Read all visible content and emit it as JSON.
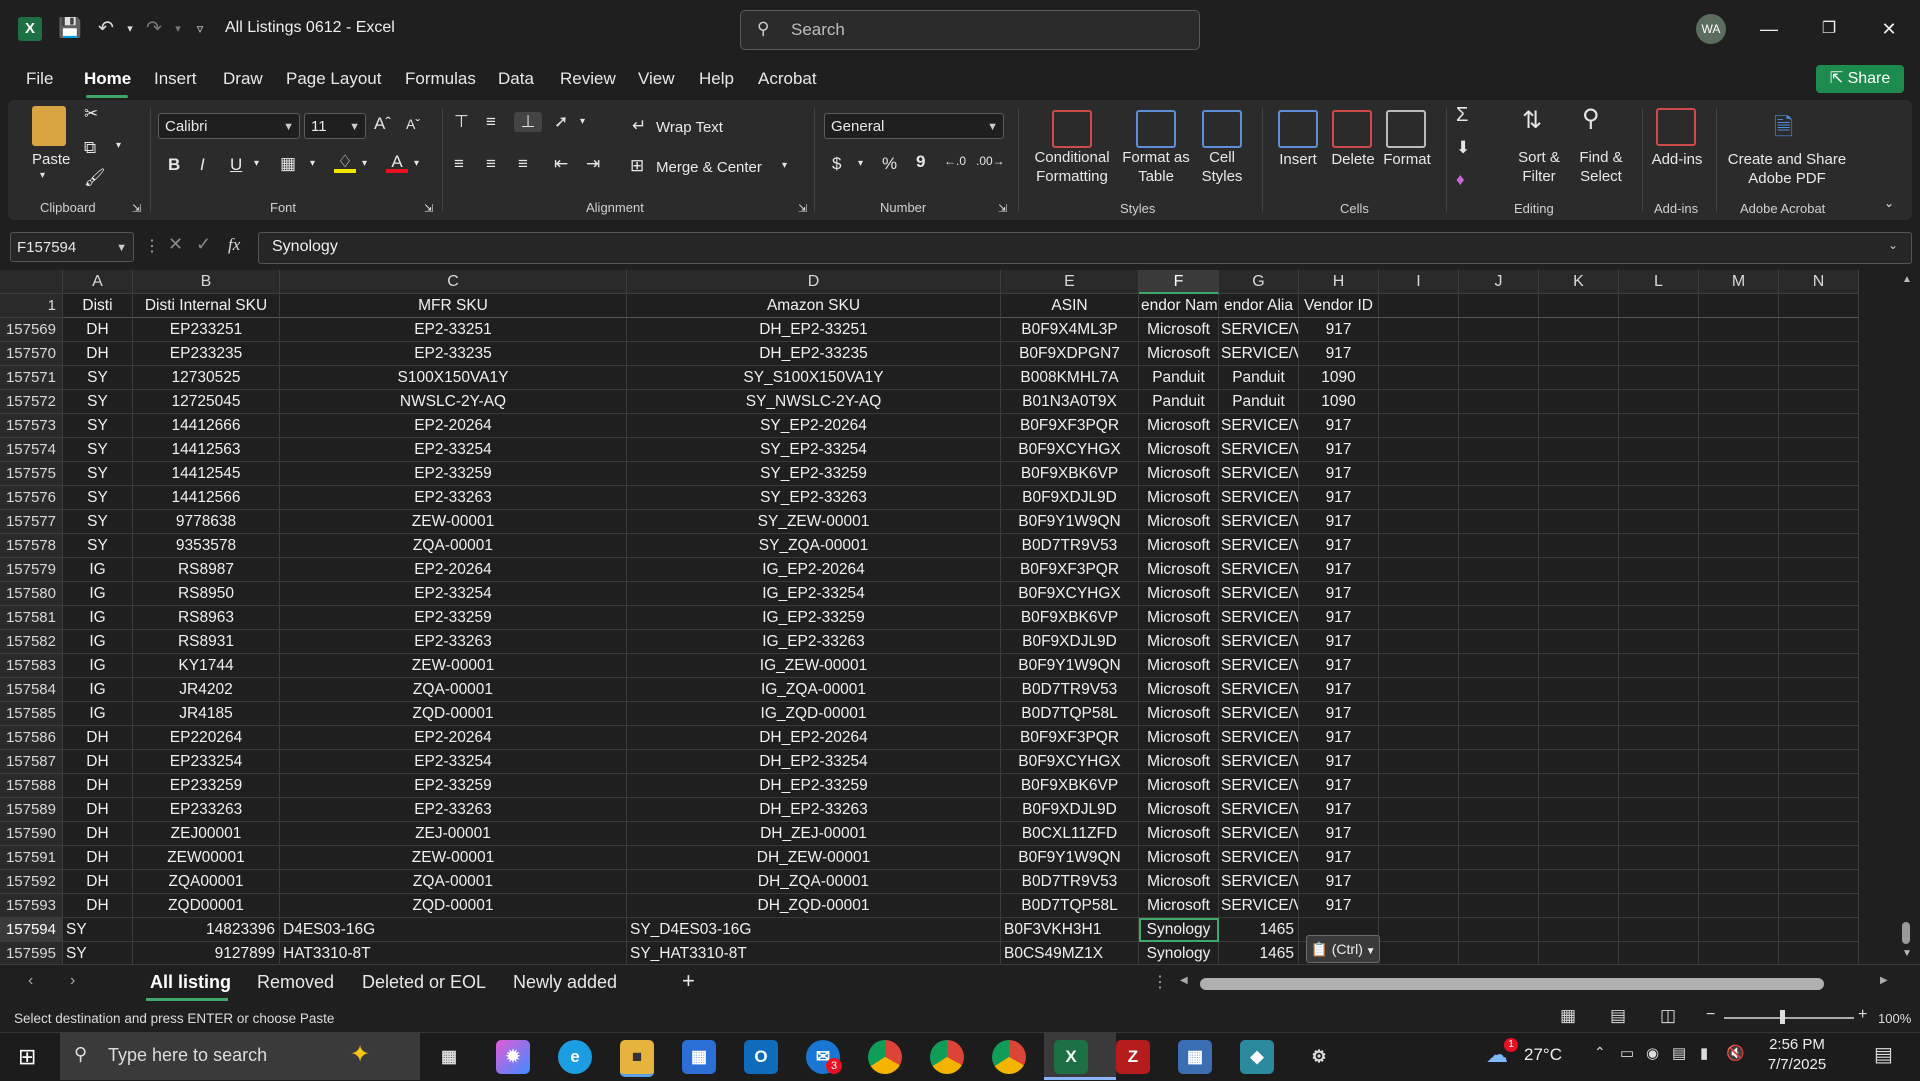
{
  "window": {
    "title": "All Listings 0612  -  Excel",
    "app_logo": "X",
    "avatar": "WA",
    "search_placeholder": "Search"
  },
  "menu": [
    "File",
    "Home",
    "Insert",
    "Draw",
    "Page Layout",
    "Formulas",
    "Data",
    "Review",
    "View",
    "Help",
    "Acrobat"
  ],
  "share_label": "Share",
  "ribbon": {
    "clipboard": {
      "paste": "Paste",
      "group": "Clipboard"
    },
    "font": {
      "name": "Calibri",
      "size": "11",
      "bold": "B",
      "italic": "I",
      "underline": "U",
      "group": "Font"
    },
    "alignment": {
      "wrap": "Wrap Text",
      "merge": "Merge & Center",
      "group": "Alignment"
    },
    "number": {
      "format": "General",
      "currency": "$",
      "percent": "%",
      "comma": "9",
      "group": "Number"
    },
    "styles": {
      "conditional": "Conditional\nFormatting",
      "format_table": "Format as\nTable",
      "cell_styles": "Cell\nStyles",
      "group": "Styles"
    },
    "cells": {
      "insert": "Insert",
      "delete": "Delete",
      "format": "Format",
      "group": "Cells"
    },
    "editing": {
      "sort": "Sort &\nFilter",
      "find": "Find &\nSelect",
      "group": "Editing"
    },
    "addins": {
      "label": "Add-ins",
      "group": "Add-ins"
    },
    "acrobat": {
      "label": "Create and Share\nAdobe PDF",
      "group": "Adobe Acrobat"
    }
  },
  "formula_bar": {
    "name_box": "F157594",
    "fx": "fx",
    "value": "Synology"
  },
  "columns": [
    "A",
    "B",
    "C",
    "D",
    "E",
    "F",
    "G",
    "H",
    "I",
    "J",
    "K",
    "L",
    "M",
    "N"
  ],
  "selected_column": "F",
  "header_row": {
    "num": "1",
    "cells": [
      "Disti",
      "Disti Internal SKU",
      "MFR SKU",
      "Amazon SKU",
      "ASIN",
      "endor Nam",
      "endor Alia",
      "Vendor ID"
    ]
  },
  "rows": [
    {
      "num": "157569",
      "cells": [
        "DH",
        "EP233251",
        "EP2-33251",
        "DH_EP2-33251",
        "B0F9X4ML3P",
        "Microsoft",
        "SERVICE/V",
        "917"
      ]
    },
    {
      "num": "157570",
      "cells": [
        "DH",
        "EP233235",
        "EP2-33235",
        "DH_EP2-33235",
        "B0F9XDPGN7",
        "Microsoft",
        "SERVICE/V",
        "917"
      ]
    },
    {
      "num": "157571",
      "cells": [
        "SY",
        "12730525",
        "S100X150VA1Y",
        "SY_S100X150VA1Y",
        "B008KMHL7A",
        "Panduit",
        "Panduit",
        "1090"
      ]
    },
    {
      "num": "157572",
      "cells": [
        "SY",
        "12725045",
        "NWSLC-2Y-AQ",
        "SY_NWSLC-2Y-AQ",
        "B01N3A0T9X",
        "Panduit",
        "Panduit",
        "1090"
      ]
    },
    {
      "num": "157573",
      "cells": [
        "SY",
        "14412666",
        "EP2-20264",
        "SY_EP2-20264",
        "B0F9XF3PQR",
        "Microsoft",
        "SERVICE/V",
        "917"
      ]
    },
    {
      "num": "157574",
      "cells": [
        "SY",
        "14412563",
        "EP2-33254",
        "SY_EP2-33254",
        "B0F9XCYHGX",
        "Microsoft",
        "SERVICE/V",
        "917"
      ]
    },
    {
      "num": "157575",
      "cells": [
        "SY",
        "14412545",
        "EP2-33259",
        "SY_EP2-33259",
        "B0F9XBK6VP",
        "Microsoft",
        "SERVICE/V",
        "917"
      ]
    },
    {
      "num": "157576",
      "cells": [
        "SY",
        "14412566",
        "EP2-33263",
        "SY_EP2-33263",
        "B0F9XDJL9D",
        "Microsoft",
        "SERVICE/V",
        "917"
      ]
    },
    {
      "num": "157577",
      "cells": [
        "SY",
        "9778638",
        "ZEW-00001",
        "SY_ZEW-00001",
        "B0F9Y1W9QN",
        "Microsoft",
        "SERVICE/V",
        "917"
      ]
    },
    {
      "num": "157578",
      "cells": [
        "SY",
        "9353578",
        "ZQA-00001",
        "SY_ZQA-00001",
        "B0D7TR9V53",
        "Microsoft",
        "SERVICE/V",
        "917"
      ]
    },
    {
      "num": "157579",
      "cells": [
        "IG",
        "RS8987",
        "EP2-20264",
        "IG_EP2-20264",
        "B0F9XF3PQR",
        "Microsoft",
        "SERVICE/V",
        "917"
      ]
    },
    {
      "num": "157580",
      "cells": [
        "IG",
        "RS8950",
        "EP2-33254",
        "IG_EP2-33254",
        "B0F9XCYHGX",
        "Microsoft",
        "SERVICE/V",
        "917"
      ]
    },
    {
      "num": "157581",
      "cells": [
        "IG",
        "RS8963",
        "EP2-33259",
        "IG_EP2-33259",
        "B0F9XBK6VP",
        "Microsoft",
        "SERVICE/V",
        "917"
      ]
    },
    {
      "num": "157582",
      "cells": [
        "IG",
        "RS8931",
        "EP2-33263",
        "IG_EP2-33263",
        "B0F9XDJL9D",
        "Microsoft",
        "SERVICE/V",
        "917"
      ]
    },
    {
      "num": "157583",
      "cells": [
        "IG",
        "KY1744",
        "ZEW-00001",
        "IG_ZEW-00001",
        "B0F9Y1W9QN",
        "Microsoft",
        "SERVICE/V",
        "917"
      ]
    },
    {
      "num": "157584",
      "cells": [
        "IG",
        "JR4202",
        "ZQA-00001",
        "IG_ZQA-00001",
        "B0D7TR9V53",
        "Microsoft",
        "SERVICE/V",
        "917"
      ]
    },
    {
      "num": "157585",
      "cells": [
        "IG",
        "JR4185",
        "ZQD-00001",
        "IG_ZQD-00001",
        "B0D7TQP58L",
        "Microsoft",
        "SERVICE/V",
        "917"
      ]
    },
    {
      "num": "157586",
      "cells": [
        "DH",
        "EP220264",
        "EP2-20264",
        "DH_EP2-20264",
        "B0F9XF3PQR",
        "Microsoft",
        "SERVICE/V",
        "917"
      ]
    },
    {
      "num": "157587",
      "cells": [
        "DH",
        "EP233254",
        "EP2-33254",
        "DH_EP2-33254",
        "B0F9XCYHGX",
        "Microsoft",
        "SERVICE/V",
        "917"
      ]
    },
    {
      "num": "157588",
      "cells": [
        "DH",
        "EP233259",
        "EP2-33259",
        "DH_EP2-33259",
        "B0F9XBK6VP",
        "Microsoft",
        "SERVICE/V",
        "917"
      ]
    },
    {
      "num": "157589",
      "cells": [
        "DH",
        "EP233263",
        "EP2-33263",
        "DH_EP2-33263",
        "B0F9XDJL9D",
        "Microsoft",
        "SERVICE/V",
        "917"
      ]
    },
    {
      "num": "157590",
      "cells": [
        "DH",
        "ZEJ00001",
        "ZEJ-00001",
        "DH_ZEJ-00001",
        "B0CXL11ZFD",
        "Microsoft",
        "SERVICE/V",
        "917"
      ]
    },
    {
      "num": "157591",
      "cells": [
        "DH",
        "ZEW00001",
        "ZEW-00001",
        "DH_ZEW-00001",
        "B0F9Y1W9QN",
        "Microsoft",
        "SERVICE/V",
        "917"
      ]
    },
    {
      "num": "157592",
      "cells": [
        "DH",
        "ZQA00001",
        "ZQA-00001",
        "DH_ZQA-00001",
        "B0D7TR9V53",
        "Microsoft",
        "SERVICE/V",
        "917"
      ]
    },
    {
      "num": "157593",
      "cells": [
        "DH",
        "ZQD00001",
        "ZQD-00001",
        "DH_ZQD-00001",
        "B0D7TQP58L",
        "Microsoft",
        "SERVICE/V",
        "917"
      ]
    }
  ],
  "pasted_rows": [
    {
      "num": "157594",
      "cells": [
        "SY",
        "14823396",
        "D4ES03-16G",
        "SY_D4ES03-16G",
        "B0F3VKH3H1",
        "Synology",
        "1465",
        ""
      ]
    },
    {
      "num": "157595",
      "cells": [
        "SY",
        "9127899",
        "HAT3310-8T",
        "SY_HAT3310-8T",
        "B0CS49MZ1X",
        "Synology",
        "1465",
        ""
      ]
    }
  ],
  "paste_options": "(Ctrl)",
  "sheets": [
    "All listing",
    "Removed",
    "Deleted or EOL",
    "Newly added"
  ],
  "add_sheet": "+",
  "status": {
    "message": "Select destination and press ENTER or choose Paste",
    "zoom": "100%"
  },
  "taskbar": {
    "search_placeholder": "Type here to search",
    "weather": "27°C",
    "weather_badge": "1",
    "time": "2:56 PM",
    "date": "7/7/2025",
    "outlook_badge": "3"
  },
  "colors": {
    "accent": "#3fa86b",
    "excel_green": "#1d7044",
    "share_green": "#1d8a4e"
  }
}
